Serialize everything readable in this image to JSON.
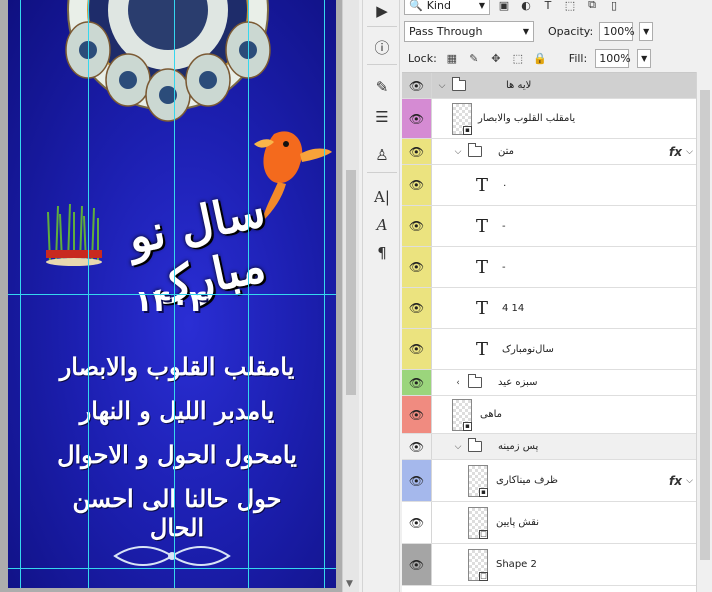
{
  "toolbar": {
    "kind_label": "Kind",
    "blend_mode": "Pass Through",
    "opacity_label": "Opacity:",
    "opacity_value": "100%",
    "lock_label": "Lock:",
    "fill_label": "Fill:",
    "fill_value": "100%"
  },
  "artwork": {
    "title": "سال نو مبارک",
    "year": "۱۴۰۴",
    "prayer_lines": [
      "یامقلب القلوب والابصار",
      "یامدبر اللیل و النهار",
      "یامحول الحول و الاحوال",
      "حول حالنا الی احسن الحال"
    ]
  },
  "layers": [
    {
      "name": "لایه ها",
      "type": "group",
      "color": "#d0d0d0",
      "expanded": true
    },
    {
      "name": "یامقلب القلوب والابصار",
      "type": "smart",
      "color": "#d58bd3"
    },
    {
      "name": "متن",
      "type": "group",
      "color": "#ebe37f",
      "expanded": true,
      "fx": true
    },
    {
      "name": "٠",
      "type": "text",
      "color": "#ebe37f"
    },
    {
      "name": "-",
      "type": "text",
      "color": "#ebe37f"
    },
    {
      "name": "-",
      "type": "text",
      "color": "#ebe37f"
    },
    {
      "name": "4  14",
      "type": "text",
      "color": "#ebe37f"
    },
    {
      "name": "سال‌نومبارک",
      "type": "text",
      "color": "#ebe37f"
    },
    {
      "name": "سبزه عید",
      "type": "group",
      "color": "#9bd57c",
      "expanded": false
    },
    {
      "name": "ماهی",
      "type": "smart",
      "color": "#f08b80"
    },
    {
      "name": "پس زمینه",
      "type": "group",
      "color": "#f0f0f0",
      "expanded": true
    },
    {
      "name": "ظرف میناکاری",
      "type": "smart",
      "color": "#a5b8ec",
      "fx": true
    },
    {
      "name": "نقش پایین",
      "type": "shape",
      "color": "#f0f0f0"
    },
    {
      "name": "Shape 2",
      "type": "shape",
      "color": "#a5a5a5"
    }
  ],
  "icons": {
    "eye": "eye-icon",
    "fx": "fx-icon"
  }
}
